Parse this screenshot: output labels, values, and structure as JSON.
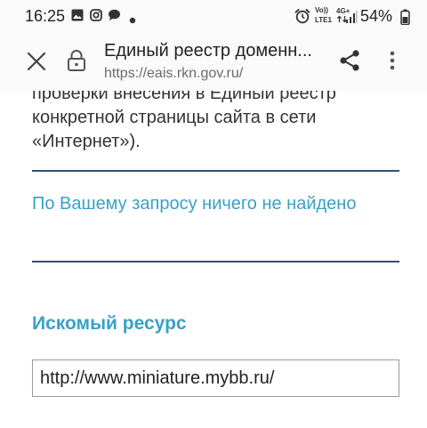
{
  "status_bar": {
    "time": "16:25",
    "battery_percent": "54%",
    "network_label": "4G+",
    "volte_label": "Vo))",
    "lte_label": "LTE1",
    "icons": [
      "gallery-icon",
      "instagram-icon",
      "chat-bubble-icon",
      "dot-icon",
      "alarm-icon",
      "volte-icon",
      "network-4g-icon",
      "signal-icon",
      "battery-icon"
    ]
  },
  "toolbar": {
    "title": "Единый реестр доменн...",
    "url": "https://eais.rkn.gov.ru/",
    "icons": [
      "close-icon",
      "lock-icon",
      "share-icon",
      "more-vert-icon"
    ]
  },
  "content": {
    "intro_lines": [
      "проверки внесения в Единый реестр",
      "конкретной страницы сайта в сети",
      "«Интернет»)."
    ],
    "not_found": "По Вашему запросу ничего не найдено",
    "resource_heading": "Искомый ресурс",
    "resource_value": "http://www.miniature.mybb.ru/"
  },
  "colors": {
    "accent": "#3aa0c8",
    "divider": "#2f4f6f",
    "text": "#333333"
  }
}
